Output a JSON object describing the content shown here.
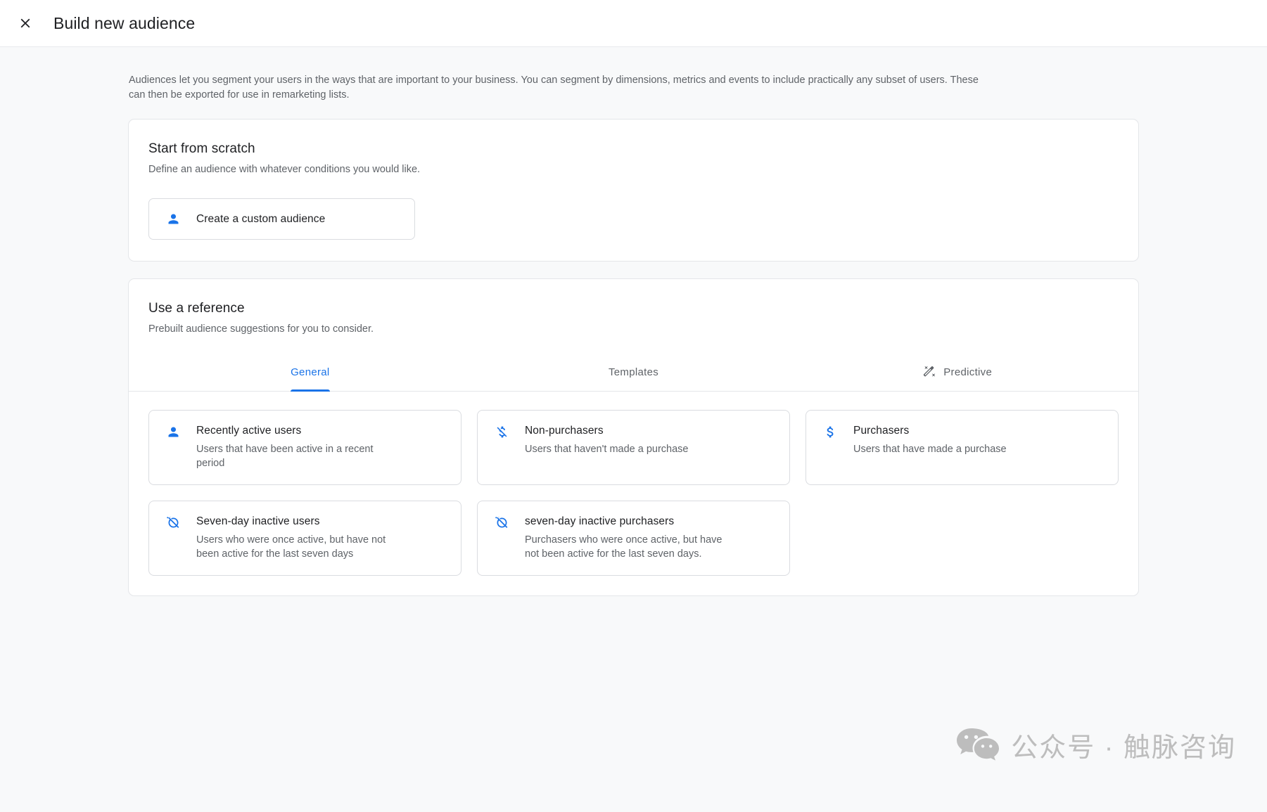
{
  "header": {
    "title": "Build new audience",
    "close_icon": "close-icon"
  },
  "intro": "Audiences let you segment your users in the ways that are important to your business. You can segment by dimensions, metrics and events to include practically any subset of users. These can then be exported for use in remarketing lists.",
  "scratch": {
    "title": "Start from scratch",
    "subtitle": "Define an audience with whatever conditions you would like.",
    "button": {
      "label": "Create a custom audience",
      "icon": "person-icon"
    }
  },
  "reference": {
    "title": "Use a reference",
    "subtitle": "Prebuilt audience suggestions for you to consider.",
    "tabs": [
      {
        "label": "General",
        "active": true,
        "icon": null
      },
      {
        "label": "Templates",
        "active": false,
        "icon": null
      },
      {
        "label": "Predictive",
        "active": false,
        "icon": "magic-wand-icon"
      }
    ],
    "suggestions": [
      {
        "title": "Recently active users",
        "description": "Users that have been active in a recent period",
        "icon": "person-icon"
      },
      {
        "title": "Non-purchasers",
        "description": "Users that haven't made a purchase",
        "icon": "money-off-icon"
      },
      {
        "title": "Purchasers",
        "description": "Users that have made a purchase",
        "icon": "dollar-icon"
      },
      {
        "title": "Seven-day inactive users",
        "description": "Users who were once active, but have not been active for the last seven days",
        "icon": "alarm-off-icon"
      },
      {
        "title": "seven-day inactive purchasers",
        "description": "Purchasers who were once active, but have not been active for the last seven days.",
        "icon": "alarm-off-icon"
      }
    ]
  },
  "watermark": {
    "text": "公众号 · 触脉咨询",
    "icon": "wechat-icon"
  },
  "colors": {
    "accent": "#1a73e8",
    "text_primary": "#202124",
    "text_secondary": "#5f6368",
    "page_background": "#f8f9fa",
    "card_background": "#ffffff",
    "border": "#dadce0"
  }
}
